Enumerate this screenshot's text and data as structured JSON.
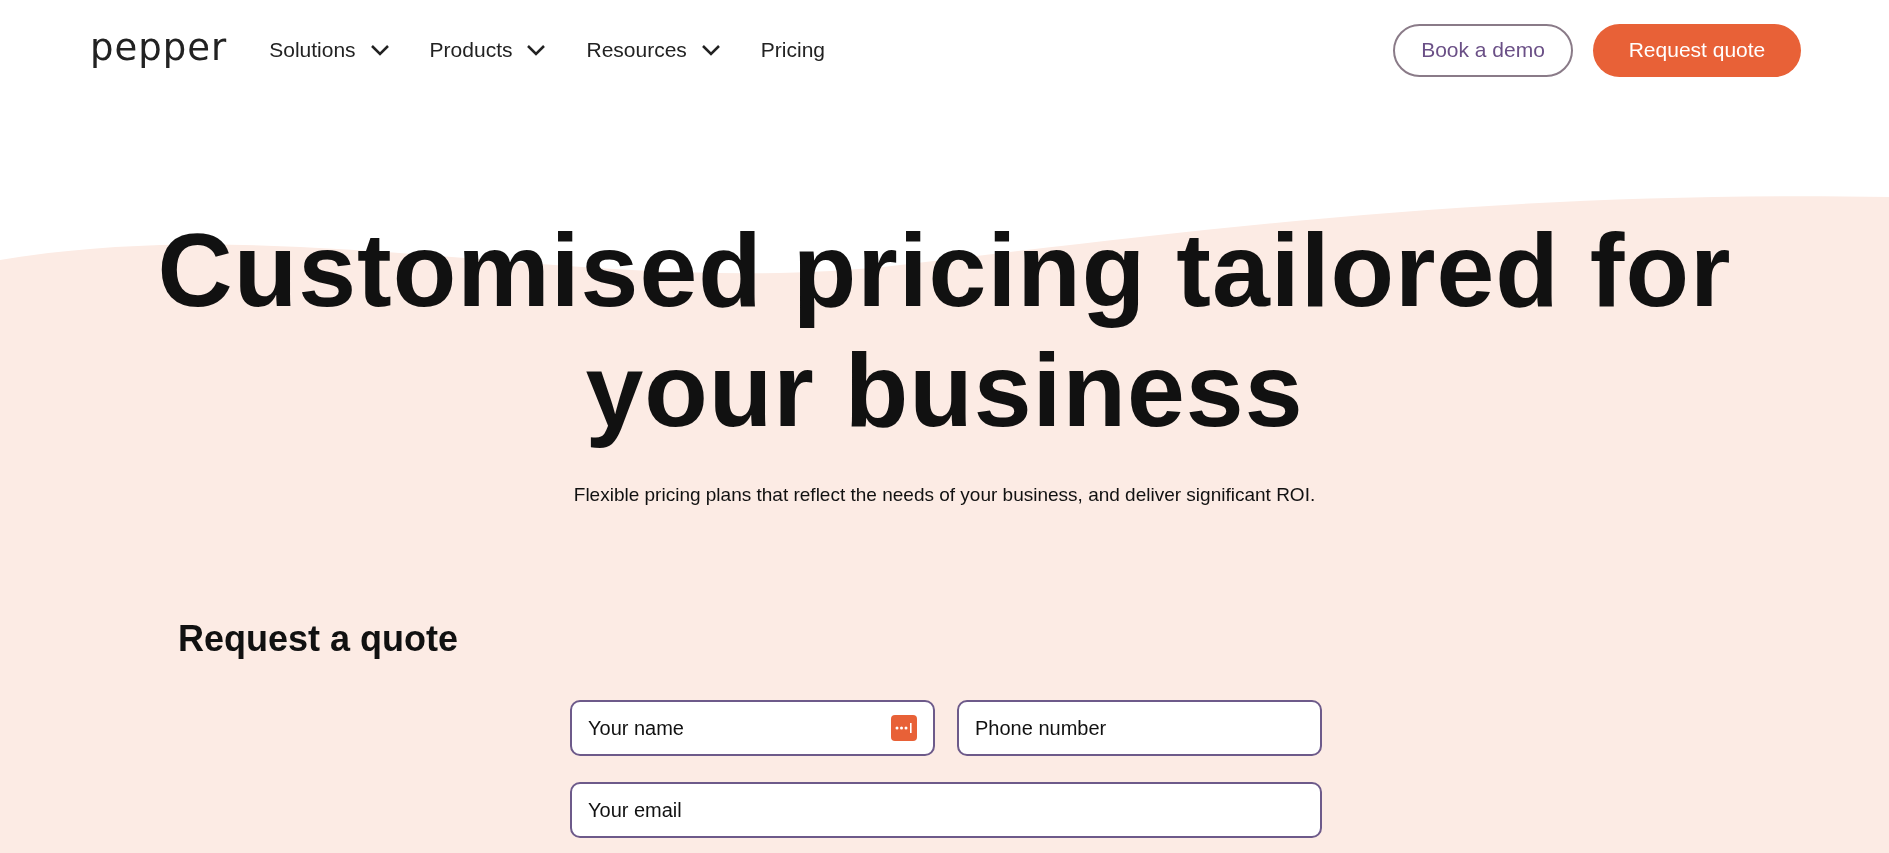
{
  "header": {
    "logo": "pepper",
    "nav": [
      {
        "label": "Solutions",
        "dropdown": true
      },
      {
        "label": "Products",
        "dropdown": true
      },
      {
        "label": "Resources",
        "dropdown": true
      },
      {
        "label": "Pricing",
        "dropdown": false
      }
    ],
    "buttons": [
      {
        "label": "Book a demo",
        "kind": "outline"
      },
      {
        "label": "Request quote",
        "kind": "primary"
      }
    ]
  },
  "hero": {
    "title_lines": [
      "Customised pricing tailored for",
      "your business"
    ],
    "subtitle": "Flexible pricing plans that reflect the needs of your business, and deliver significant ROI."
  },
  "form": {
    "title": "Request a quote",
    "rows": [
      [
        {
          "placeholder": "Your name",
          "autofill_icon": true
        },
        {
          "placeholder": "Phone number",
          "autofill_icon": false
        }
      ],
      [
        {
          "placeholder": "Your email",
          "autofill_icon": false
        }
      ]
    ]
  }
}
